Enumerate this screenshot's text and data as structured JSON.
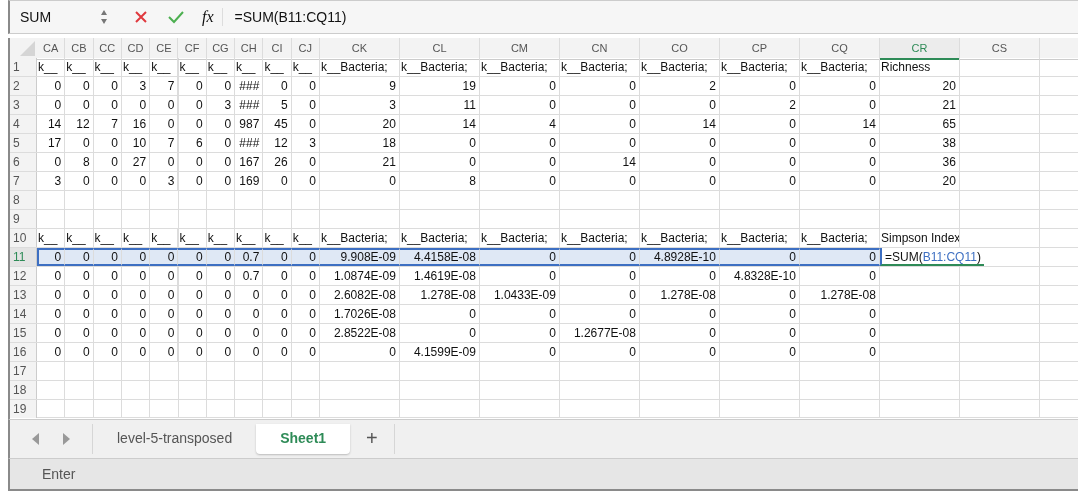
{
  "formula_bar": {
    "name_box": "SUM",
    "function_label": "fx",
    "formula": "=SUM(B11:CQ11)"
  },
  "columns": [
    {
      "label": "CA",
      "selected": false
    },
    {
      "label": "CB",
      "selected": false
    },
    {
      "label": "CC",
      "selected": false
    },
    {
      "label": "CD",
      "selected": false
    },
    {
      "label": "CE",
      "selected": false
    },
    {
      "label": "CF",
      "selected": false
    },
    {
      "label": "CG",
      "selected": false
    },
    {
      "label": "CH",
      "selected": false
    },
    {
      "label": "CI",
      "selected": false
    },
    {
      "label": "CJ",
      "selected": false
    },
    {
      "label": "CK",
      "selected": false
    },
    {
      "label": "CL",
      "selected": false
    },
    {
      "label": "CM",
      "selected": false
    },
    {
      "label": "CN",
      "selected": false
    },
    {
      "label": "CO",
      "selected": false
    },
    {
      "label": "CP",
      "selected": false
    },
    {
      "label": "CQ",
      "selected": false
    },
    {
      "label": "CR",
      "selected": true
    },
    {
      "label": "CS",
      "selected": false
    }
  ],
  "rows": [
    {
      "number": "1",
      "kind": "header",
      "selected": false,
      "cells": [
        "k__",
        "k__",
        "k__",
        "k__",
        "k__",
        "k__",
        "k__",
        "k__",
        "k__",
        "k__",
        "k__Bacteria;",
        "k__Bacteria;",
        "k__Bacteria;",
        "k__Bacteria;",
        "k__Bacteria;",
        "k__Bacteria;",
        "k__Bacteria;",
        "Richness"
      ]
    },
    {
      "number": "2",
      "kind": "data",
      "selected": false,
      "cells": [
        "0",
        "0",
        "0",
        "3",
        "7",
        "0",
        "0",
        "###",
        "0",
        "0",
        "9",
        "19",
        "0",
        "0",
        "2",
        "0",
        "0",
        "20"
      ]
    },
    {
      "number": "3",
      "kind": "data",
      "selected": false,
      "cells": [
        "0",
        "0",
        "0",
        "0",
        "0",
        "0",
        "3",
        "###",
        "5",
        "0",
        "3",
        "11",
        "0",
        "0",
        "0",
        "2",
        "0",
        "21"
      ]
    },
    {
      "number": "4",
      "kind": "data",
      "selected": false,
      "cells": [
        "14",
        "12",
        "7",
        "16",
        "0",
        "0",
        "0",
        "987",
        "45",
        "0",
        "20",
        "14",
        "4",
        "0",
        "14",
        "0",
        "14",
        "65"
      ]
    },
    {
      "number": "5",
      "kind": "data",
      "selected": false,
      "cells": [
        "17",
        "0",
        "0",
        "10",
        "7",
        "6",
        "0",
        "###",
        "12",
        "3",
        "18",
        "0",
        "0",
        "0",
        "0",
        "0",
        "0",
        "38"
      ]
    },
    {
      "number": "6",
      "kind": "data",
      "selected": false,
      "cells": [
        "0",
        "8",
        "0",
        "27",
        "0",
        "0",
        "0",
        "167",
        "26",
        "0",
        "21",
        "0",
        "0",
        "14",
        "0",
        "0",
        "0",
        "36"
      ]
    },
    {
      "number": "7",
      "kind": "data",
      "selected": false,
      "cells": [
        "3",
        "0",
        "0",
        "0",
        "3",
        "0",
        "0",
        "169",
        "0",
        "0",
        "0",
        "8",
        "0",
        "0",
        "0",
        "0",
        "0",
        "20"
      ]
    },
    {
      "number": "8",
      "selected": false
    },
    {
      "number": "9",
      "selected": false
    },
    {
      "number": "10",
      "kind": "header",
      "selected": false,
      "cells": [
        "k__",
        "k__",
        "k__",
        "k__",
        "k__",
        "k__",
        "k__",
        "k__",
        "k__",
        "k__",
        "k__Bacteria;",
        "k__Bacteria;",
        "k__Bacteria;",
        "k__Bacteria;",
        "k__Bacteria;",
        "k__Bacteria;",
        "k__Bacteria;",
        "Simpson Index"
      ]
    },
    {
      "number": "11",
      "kind": "data",
      "selected": true,
      "cells": [
        "0",
        "0",
        "0",
        "0",
        "0",
        "0",
        "0",
        "0.7",
        "0",
        "0",
        "9.908E-09",
        "4.4158E-08",
        "0",
        "0",
        "4.8928E-10",
        "0",
        "0",
        {
          "kind": "formula",
          "prefix": "=SUM(",
          "reference": "B11:CQ11",
          "suffix": ")"
        }
      ]
    },
    {
      "number": "12",
      "kind": "data",
      "selected": false,
      "cells": [
        "0",
        "0",
        "0",
        "0",
        "0",
        "0",
        "0",
        "0.7",
        "0",
        "0",
        "1.0874E-09",
        "1.4619E-08",
        "0",
        "0",
        "0",
        "4.8328E-10",
        "0"
      ]
    },
    {
      "number": "13",
      "kind": "data",
      "selected": false,
      "cells": [
        "0",
        "0",
        "0",
        "0",
        "0",
        "0",
        "0",
        "0",
        "0",
        "0",
        "2.6082E-08",
        "1.278E-08",
        "1.0433E-09",
        "0",
        "1.278E-08",
        "0",
        "1.278E-08"
      ]
    },
    {
      "number": "14",
      "kind": "data",
      "selected": false,
      "cells": [
        "0",
        "0",
        "0",
        "0",
        "0",
        "0",
        "0",
        "0",
        "0",
        "0",
        "1.7026E-08",
        "0",
        "0",
        "0",
        "0",
        "0",
        "0"
      ]
    },
    {
      "number": "15",
      "kind": "data",
      "selected": false,
      "cells": [
        "0",
        "0",
        "0",
        "0",
        "0",
        "0",
        "0",
        "0",
        "0",
        "0",
        "2.8522E-08",
        "0",
        "0",
        "1.2677E-08",
        "0",
        "0",
        "0"
      ]
    },
    {
      "number": "16",
      "kind": "data",
      "selected": false,
      "cells": [
        "0",
        "0",
        "0",
        "0",
        "0",
        "0",
        "0",
        "0",
        "0",
        "0",
        "0",
        "4.1599E-09",
        "0",
        "0",
        "0",
        "0",
        "0"
      ]
    },
    {
      "number": "17",
      "selected": false
    },
    {
      "number": "18",
      "selected": false
    },
    {
      "number": "19",
      "selected": false
    }
  ],
  "sheet_tabs": [
    {
      "label": "level-5-transposed",
      "selected": false
    },
    {
      "label": "Sheet1",
      "selected": true
    }
  ],
  "add_sheet": "+",
  "status_bar": "Enter"
}
